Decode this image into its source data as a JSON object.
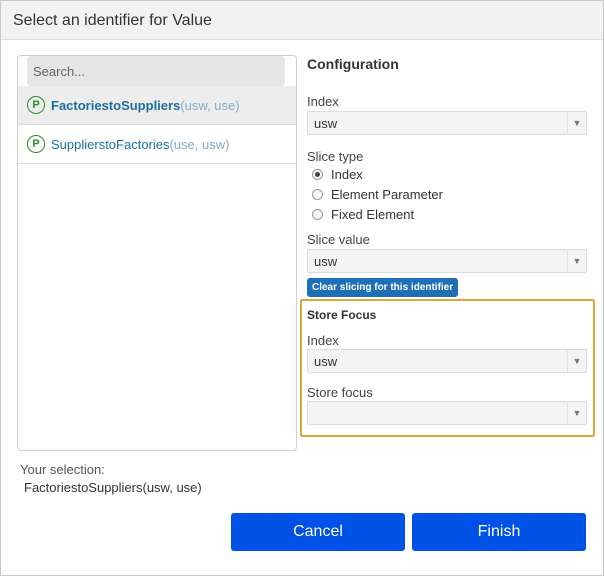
{
  "dialog": {
    "title": "Select an identifier for Value"
  },
  "search": {
    "placeholder": "Search..."
  },
  "identifiers": [
    {
      "icon": "P",
      "name": "FactoriestoSuppliers",
      "args": "(usw, use)",
      "selected": true
    },
    {
      "icon": "P",
      "name": "SupplierstoFactories",
      "args": "(use, usw)",
      "selected": false
    }
  ],
  "config": {
    "heading": "Configuration",
    "index_label": "Index",
    "index_value": "usw",
    "slice_type_label": "Slice type",
    "slice_options": [
      "Index",
      "Element Parameter",
      "Fixed Element"
    ],
    "slice_selected": "Index",
    "slice_value_label": "Slice value",
    "slice_value": "usw",
    "clear_button": "Clear slicing for this identifier"
  },
  "store_focus": {
    "heading": "Store Focus",
    "index_label": "Index",
    "index_value": "usw",
    "focus_label": "Store focus",
    "focus_value": ""
  },
  "selection": {
    "label": "Your selection:",
    "value": "FactoriestoSuppliers(usw, use)"
  },
  "buttons": {
    "cancel": "Cancel",
    "finish": "Finish"
  },
  "colors": {
    "primary": "#0052e6",
    "highlight_border": "#d9a93c",
    "clear_button": "#1e6fb5"
  }
}
